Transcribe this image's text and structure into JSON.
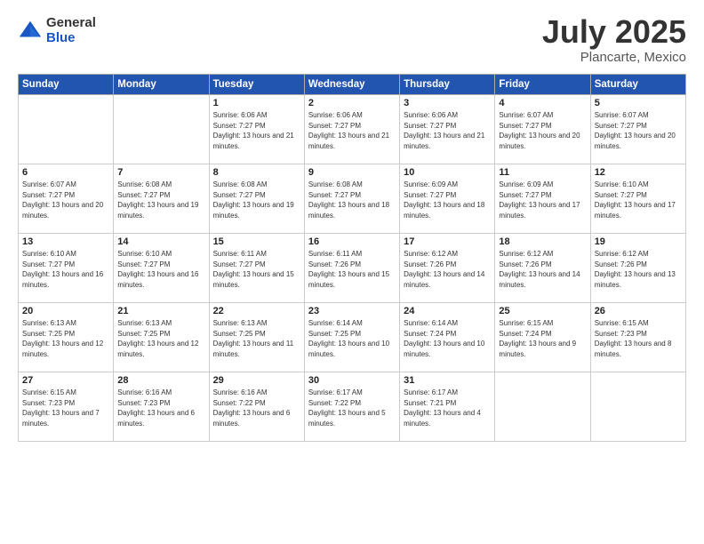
{
  "logo": {
    "general": "General",
    "blue": "Blue"
  },
  "title": "July 2025",
  "subtitle": "Plancarte, Mexico",
  "header_days": [
    "Sunday",
    "Monday",
    "Tuesday",
    "Wednesday",
    "Thursday",
    "Friday",
    "Saturday"
  ],
  "weeks": [
    [
      {
        "day": "",
        "info": ""
      },
      {
        "day": "",
        "info": ""
      },
      {
        "day": "1",
        "info": "Sunrise: 6:06 AM\nSunset: 7:27 PM\nDaylight: 13 hours and 21 minutes."
      },
      {
        "day": "2",
        "info": "Sunrise: 6:06 AM\nSunset: 7:27 PM\nDaylight: 13 hours and 21 minutes."
      },
      {
        "day": "3",
        "info": "Sunrise: 6:06 AM\nSunset: 7:27 PM\nDaylight: 13 hours and 21 minutes."
      },
      {
        "day": "4",
        "info": "Sunrise: 6:07 AM\nSunset: 7:27 PM\nDaylight: 13 hours and 20 minutes."
      },
      {
        "day": "5",
        "info": "Sunrise: 6:07 AM\nSunset: 7:27 PM\nDaylight: 13 hours and 20 minutes."
      }
    ],
    [
      {
        "day": "6",
        "info": "Sunrise: 6:07 AM\nSunset: 7:27 PM\nDaylight: 13 hours and 20 minutes."
      },
      {
        "day": "7",
        "info": "Sunrise: 6:08 AM\nSunset: 7:27 PM\nDaylight: 13 hours and 19 minutes."
      },
      {
        "day": "8",
        "info": "Sunrise: 6:08 AM\nSunset: 7:27 PM\nDaylight: 13 hours and 19 minutes."
      },
      {
        "day": "9",
        "info": "Sunrise: 6:08 AM\nSunset: 7:27 PM\nDaylight: 13 hours and 18 minutes."
      },
      {
        "day": "10",
        "info": "Sunrise: 6:09 AM\nSunset: 7:27 PM\nDaylight: 13 hours and 18 minutes."
      },
      {
        "day": "11",
        "info": "Sunrise: 6:09 AM\nSunset: 7:27 PM\nDaylight: 13 hours and 17 minutes."
      },
      {
        "day": "12",
        "info": "Sunrise: 6:10 AM\nSunset: 7:27 PM\nDaylight: 13 hours and 17 minutes."
      }
    ],
    [
      {
        "day": "13",
        "info": "Sunrise: 6:10 AM\nSunset: 7:27 PM\nDaylight: 13 hours and 16 minutes."
      },
      {
        "day": "14",
        "info": "Sunrise: 6:10 AM\nSunset: 7:27 PM\nDaylight: 13 hours and 16 minutes."
      },
      {
        "day": "15",
        "info": "Sunrise: 6:11 AM\nSunset: 7:27 PM\nDaylight: 13 hours and 15 minutes."
      },
      {
        "day": "16",
        "info": "Sunrise: 6:11 AM\nSunset: 7:26 PM\nDaylight: 13 hours and 15 minutes."
      },
      {
        "day": "17",
        "info": "Sunrise: 6:12 AM\nSunset: 7:26 PM\nDaylight: 13 hours and 14 minutes."
      },
      {
        "day": "18",
        "info": "Sunrise: 6:12 AM\nSunset: 7:26 PM\nDaylight: 13 hours and 14 minutes."
      },
      {
        "day": "19",
        "info": "Sunrise: 6:12 AM\nSunset: 7:26 PM\nDaylight: 13 hours and 13 minutes."
      }
    ],
    [
      {
        "day": "20",
        "info": "Sunrise: 6:13 AM\nSunset: 7:25 PM\nDaylight: 13 hours and 12 minutes."
      },
      {
        "day": "21",
        "info": "Sunrise: 6:13 AM\nSunset: 7:25 PM\nDaylight: 13 hours and 12 minutes."
      },
      {
        "day": "22",
        "info": "Sunrise: 6:13 AM\nSunset: 7:25 PM\nDaylight: 13 hours and 11 minutes."
      },
      {
        "day": "23",
        "info": "Sunrise: 6:14 AM\nSunset: 7:25 PM\nDaylight: 13 hours and 10 minutes."
      },
      {
        "day": "24",
        "info": "Sunrise: 6:14 AM\nSunset: 7:24 PM\nDaylight: 13 hours and 10 minutes."
      },
      {
        "day": "25",
        "info": "Sunrise: 6:15 AM\nSunset: 7:24 PM\nDaylight: 13 hours and 9 minutes."
      },
      {
        "day": "26",
        "info": "Sunrise: 6:15 AM\nSunset: 7:23 PM\nDaylight: 13 hours and 8 minutes."
      }
    ],
    [
      {
        "day": "27",
        "info": "Sunrise: 6:15 AM\nSunset: 7:23 PM\nDaylight: 13 hours and 7 minutes."
      },
      {
        "day": "28",
        "info": "Sunrise: 6:16 AM\nSunset: 7:23 PM\nDaylight: 13 hours and 6 minutes."
      },
      {
        "day": "29",
        "info": "Sunrise: 6:16 AM\nSunset: 7:22 PM\nDaylight: 13 hours and 6 minutes."
      },
      {
        "day": "30",
        "info": "Sunrise: 6:17 AM\nSunset: 7:22 PM\nDaylight: 13 hours and 5 minutes."
      },
      {
        "day": "31",
        "info": "Sunrise: 6:17 AM\nSunset: 7:21 PM\nDaylight: 13 hours and 4 minutes."
      },
      {
        "day": "",
        "info": ""
      },
      {
        "day": "",
        "info": ""
      }
    ]
  ]
}
